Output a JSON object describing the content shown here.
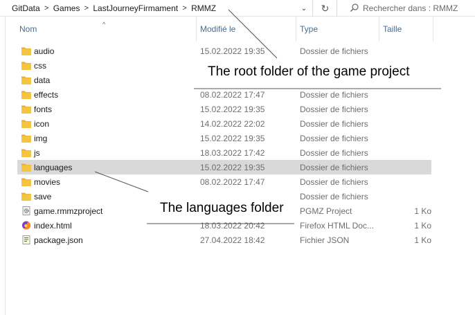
{
  "breadcrumb": {
    "items": [
      "GitData",
      "Games",
      "LastJourneyFirmament",
      "RMMZ"
    ],
    "separator": ">"
  },
  "search": {
    "placeholder": "Rechercher dans : RMMZ",
    "icon": "search-icon"
  },
  "icons": {
    "refresh": "↻",
    "dropdown": "⌄",
    "sort": "^"
  },
  "columns": {
    "name": "Nom",
    "modified": "Modifié le",
    "type": "Type",
    "size": "Taille"
  },
  "files": [
    {
      "name": "audio",
      "date": "15.02.2022 19:35",
      "type": "Dossier de fichiers",
      "size": "",
      "icon": "folder-icon"
    },
    {
      "name": "css",
      "date": "",
      "type": "",
      "size": "",
      "icon": "folder-icon"
    },
    {
      "name": "data",
      "date": "",
      "type": "",
      "size": "",
      "icon": "folder-icon"
    },
    {
      "name": "effects",
      "date": "08.02.2022 17:47",
      "type": "Dossier de fichiers",
      "size": "",
      "icon": "folder-icon"
    },
    {
      "name": "fonts",
      "date": "15.02.2022 19:35",
      "type": "Dossier de fichiers",
      "size": "",
      "icon": "folder-icon"
    },
    {
      "name": "icon",
      "date": "14.02.2022 22:02",
      "type": "Dossier de fichiers",
      "size": "",
      "icon": "folder-icon"
    },
    {
      "name": "img",
      "date": "15.02.2022 19:35",
      "type": "Dossier de fichiers",
      "size": "",
      "icon": "folder-icon"
    },
    {
      "name": "js",
      "date": "18.03.2022 17:42",
      "type": "Dossier de fichiers",
      "size": "",
      "icon": "folder-icon"
    },
    {
      "name": "languages",
      "date": "15.02.2022 19:35",
      "type": "Dossier de fichiers",
      "size": "",
      "icon": "folder-icon",
      "selected": true
    },
    {
      "name": "movies",
      "date": "08.02.2022 17:47",
      "type": "Dossier de fichiers",
      "size": "",
      "icon": "folder-icon"
    },
    {
      "name": "save",
      "date": "",
      "type": "Dossier de fichiers",
      "size": "",
      "icon": "folder-icon"
    },
    {
      "name": "game.rmmzproject",
      "date": "",
      "type": "PGMZ Project",
      "size": "1 Ko",
      "icon": "gear-file-icon"
    },
    {
      "name": "index.html",
      "date": "18.03.2022 20:42",
      "type": "Firefox HTML Doc...",
      "size": "1 Ko",
      "icon": "firefox-icon"
    },
    {
      "name": "package.json",
      "date": "27.04.2022 18:42",
      "type": "Fichier JSON",
      "size": "1 Ko",
      "icon": "json-file-icon"
    }
  ],
  "annotations": {
    "root": "The root folder of the game project",
    "languages": "The languages folder"
  },
  "colors": {
    "selected_row": "#d9d9d9",
    "folder": "#f5c542",
    "header_text": "#4a6b8a"
  }
}
